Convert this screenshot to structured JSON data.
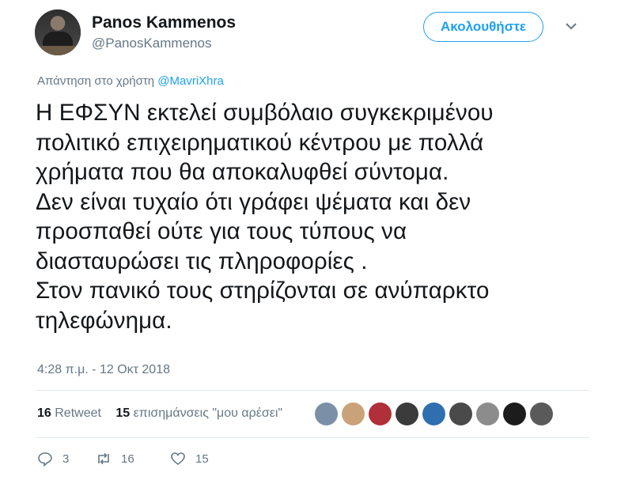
{
  "author": {
    "name": "Panos Kammenos",
    "handle": "@PanosKammenos"
  },
  "follow_label": "Ακολουθήστε",
  "reply_prefix": "Απάντηση στο χρήστη",
  "reply_to_handle": "@MavriXhra",
  "tweet_text": "Η ΕΦΣΥΝ εκτελεί συμβόλαιο συγκεκριμένου\nπολιτικό επιχειρηματικού κέντρου με  πολλά\nχρήματα που θα αποκαλυφθεί σύντομα.\nΔεν είναι τυχαίο ότι γράφει ψέματα και δεν\nπροσπαθεί ούτε για τους τύπους να\nδιασταυρώσει τις πληροφορίες .\nΣτον πανικό τους στηρίζονται σε ανύπαρκτο\nτηλεφώνημα.",
  "timestamp": "4:28 π.μ. - 12 Οκτ 2018",
  "stats": {
    "retweets_count": "16",
    "retweets_label": "Retweet",
    "likes_count": "15",
    "likes_label": "επισημάνσεις \"μου αρέσει\""
  },
  "liker_avatars": [
    {
      "color": "#7b8fa6"
    },
    {
      "color": "#c9a27a"
    },
    {
      "color": "#b0303a"
    },
    {
      "color": "#3b3b3b"
    },
    {
      "color": "#2f6fb0"
    },
    {
      "color": "#4a4a4a"
    },
    {
      "color": "#8c8c8c"
    },
    {
      "color": "#1c1c1c"
    },
    {
      "color": "#5a5a5a"
    }
  ],
  "actions": {
    "reply_count": "3",
    "retweet_count": "16",
    "like_count": "15"
  },
  "icons": [
    "chevron-down-icon",
    "reply-icon",
    "retweet-icon",
    "like-icon"
  ]
}
